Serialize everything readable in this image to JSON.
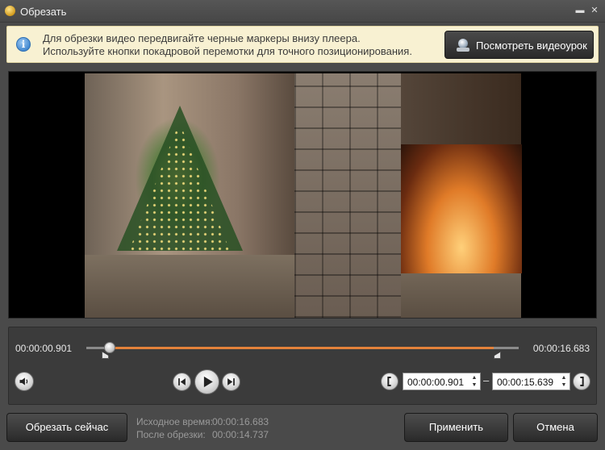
{
  "window": {
    "title": "Обрезать"
  },
  "info": {
    "line1": "Для обрезки видео передвигайте черные маркеры внизу плеера.",
    "line2": "Используйте кнопки покадровой перемотки для точного позиционирования.",
    "tutorial_button": "Посмотреть видеоурок"
  },
  "timeline": {
    "current_time": "00:00:00.901",
    "total_time": "00:00:16.683",
    "playhead_fraction": 0.054,
    "selection_start_fraction": 0.054,
    "selection_end_fraction": 0.943,
    "accent_color": "#e4823a"
  },
  "trim": {
    "start": "00:00:00.901",
    "separator": "–",
    "end": "00:00:15.639"
  },
  "stats": {
    "source_label": "Исходное время:",
    "source_value": "00:00:16.683",
    "after_label": "После обрезки:",
    "after_value": "00:00:14.737"
  },
  "buttons": {
    "cut_now": "Обрезать сейчас",
    "apply": "Применить",
    "cancel": "Отмена"
  },
  "icons": [
    "app-icon",
    "info-icon",
    "webcam-icon",
    "volume-icon",
    "prev-frame-icon",
    "play-icon",
    "next-frame-icon",
    "set-start-bracket-icon",
    "set-end-bracket-icon",
    "minimize-icon",
    "close-icon"
  ]
}
